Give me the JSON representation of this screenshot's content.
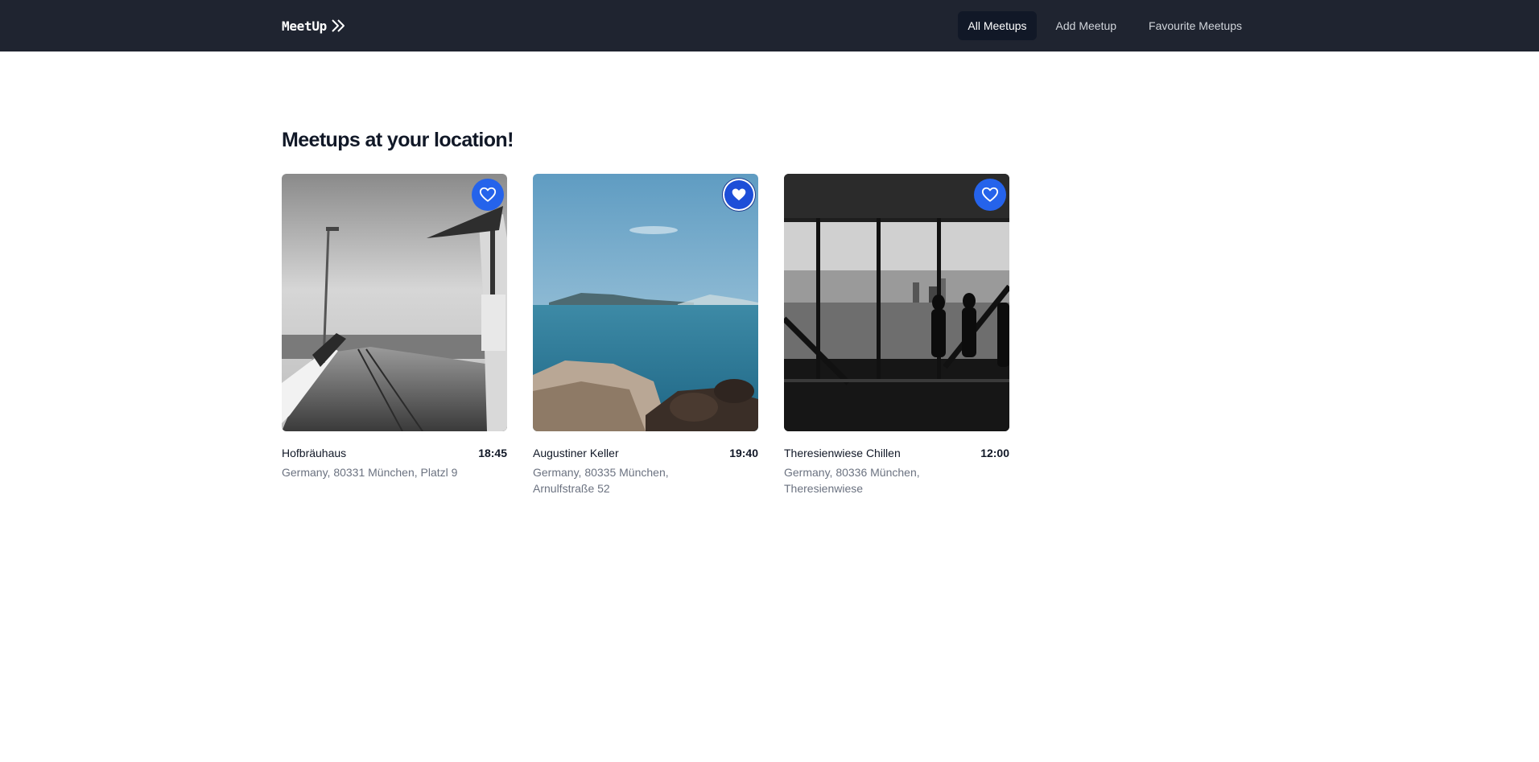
{
  "app": {
    "logo_text": "MeetUp",
    "logo_icon": "double-chevron-right-icon"
  },
  "nav": {
    "items": [
      {
        "label": "All Meetups",
        "active": true
      },
      {
        "label": "Add Meetup",
        "active": false
      },
      {
        "label": "Favourite Meetups",
        "active": false
      }
    ]
  },
  "page": {
    "title": "Meetups at your location!"
  },
  "meetups": [
    {
      "name": "Hofbräuhaus",
      "time": "18:45",
      "address": "Germany, 80331 München, Platzl 9",
      "favourite": false,
      "image": "pier-photo"
    },
    {
      "name": "Augustiner Keller",
      "time": "19:40",
      "address": "Germany, 80335 München, Arnulfstraße 52",
      "favourite": true,
      "image": "sea-photo"
    },
    {
      "name": "Theresienwiese Chillen",
      "time": "12:00",
      "address": "Germany, 80336 München, Theresienwiese",
      "favourite": false,
      "image": "city-window-photo"
    }
  ],
  "colors": {
    "topbar_bg": "#1f2430",
    "nav_active_bg": "#111827",
    "fav_button": "#2563eb"
  }
}
